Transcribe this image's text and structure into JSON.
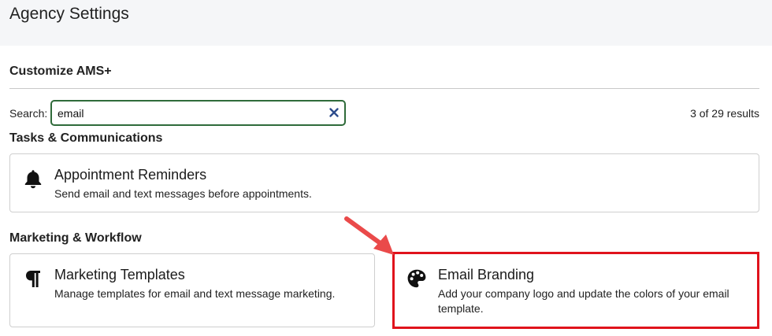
{
  "header": {
    "title": "Agency Settings"
  },
  "section": {
    "title": "Customize AMS+"
  },
  "search": {
    "label": "Search:",
    "value": "email",
    "results": "3 of 29 results"
  },
  "groups": [
    {
      "title": "Tasks & Communications",
      "cards": [
        {
          "title": "Appointment Reminders",
          "description": "Send email and text messages before appointments.",
          "icon": "bell-icon"
        }
      ]
    },
    {
      "title": "Marketing & Workflow",
      "cards": [
        {
          "title": "Marketing Templates",
          "description": "Manage templates for email and text message marketing.",
          "icon": "paragraph-icon"
        },
        {
          "title": "Email Branding",
          "description": "Add your company logo and update the colors of your email template.",
          "icon": "palette-icon"
        }
      ]
    }
  ],
  "annotation": {
    "highlight_color": "#e0131c",
    "arrow_color": "#ea4a4a"
  }
}
